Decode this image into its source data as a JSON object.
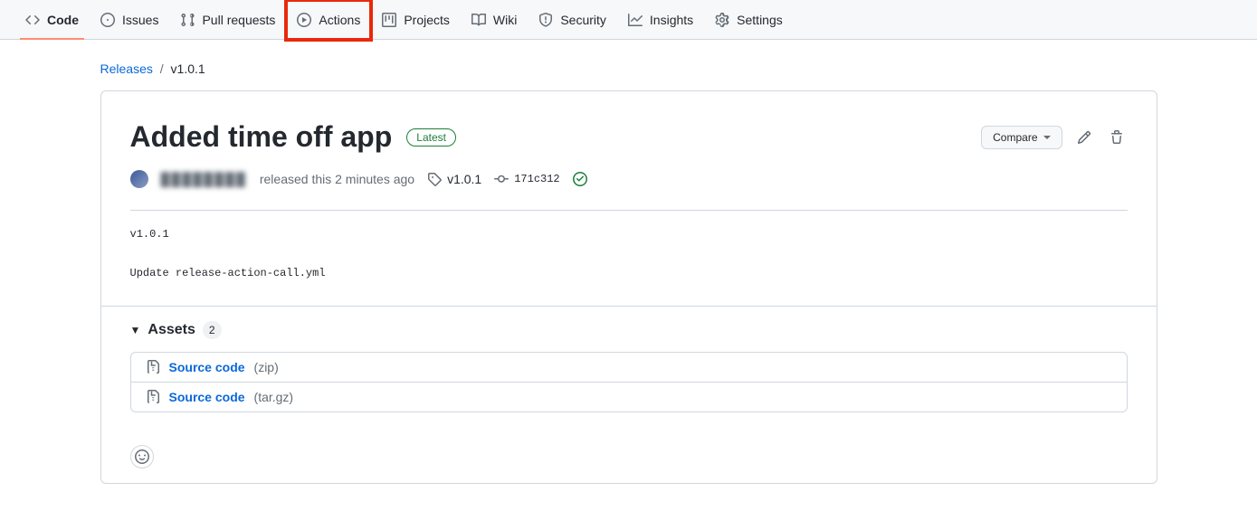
{
  "nav": {
    "code": "Code",
    "issues": "Issues",
    "pulls": "Pull requests",
    "actions": "Actions",
    "projects": "Projects",
    "wiki": "Wiki",
    "security": "Security",
    "insights": "Insights",
    "settings": "Settings"
  },
  "breadcrumb": {
    "releases": "Releases",
    "current": "v1.0.1"
  },
  "release": {
    "title": "Added time off app",
    "latest_label": "Latest",
    "compare_label": "Compare",
    "released_text": "released this 2 minutes ago",
    "tag": "v1.0.1",
    "commit": "171c312",
    "body": "v1.0.1\n\nUpdate release-action-call.yml"
  },
  "assets": {
    "header": "Assets",
    "count": "2",
    "items": [
      {
        "name": "Source code",
        "ext": "(zip)"
      },
      {
        "name": "Source code",
        "ext": "(tar.gz)"
      }
    ]
  }
}
